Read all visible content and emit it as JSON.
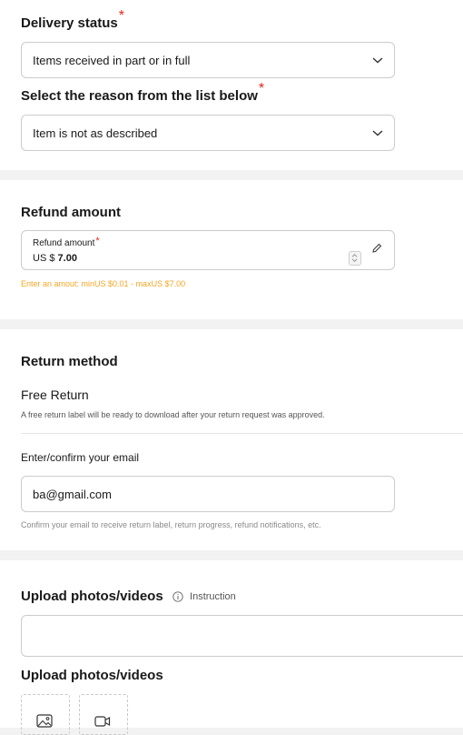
{
  "delivery": {
    "status_label": "Delivery status",
    "status_required": "*",
    "status_value": "Items received in part or in full",
    "reason_label": "Select the reason from the list below",
    "reason_required": "*",
    "reason_value": "Item is not as described"
  },
  "refund": {
    "section_title": "Refund amount",
    "field_label": "Refund amount",
    "field_required": "*",
    "currency": "US $",
    "amount": "7.00",
    "range_hint": "Enter an amout: minUS $0.01 - maxUS $7.00"
  },
  "return_method": {
    "section_title": "Return method",
    "method_name": "Free Return",
    "method_note": "A free return label will be ready to download after your return request was approved.",
    "email_label": "Enter/confirm your email",
    "email_value": "ba@gmail.com",
    "email_note": "Confirm your email to receive return label, return progress, refund notifications, etc."
  },
  "upload": {
    "section_title": "Upload photos/videos",
    "instruction_link": "Instruction",
    "second_title": "Upload photos/videos",
    "photo_icon": "image-icon",
    "video_icon": "video-camera-icon"
  },
  "colors": {
    "required": "#e1251b",
    "warning": "#f5a623",
    "border": "#cccccc"
  }
}
